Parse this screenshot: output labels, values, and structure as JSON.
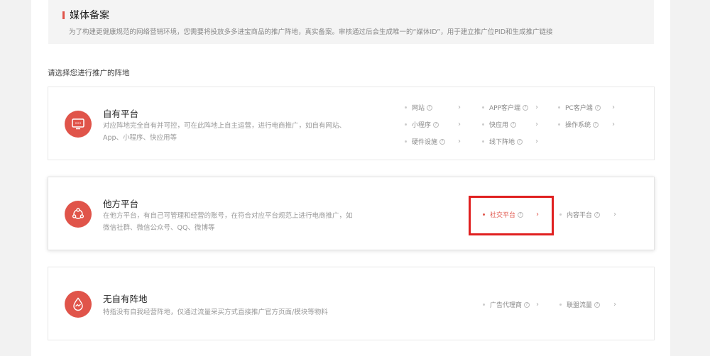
{
  "banner": {
    "title": "媒体备案",
    "description": "为了构建更健康规范的网络营销环境，您需要将投放多多进宝商品的推广阵地，真实备案。审核通过后会生成唯一的“媒体ID”，用于建立推广位PID和生成推广链接"
  },
  "prompt": "请选择您进行推广的阵地",
  "cards": [
    {
      "title": "自有平台",
      "desc": "对应阵地完全自有并可控，可在此阵地上自主运营，进行电商推广，如自有网站、App、小程序、快应用等",
      "icon": "monitor-icon",
      "options": [
        "网站",
        "APP客户端",
        "PC客户端",
        "小程序",
        "快应用",
        "操作系统",
        "硬件设施",
        "线下阵地"
      ]
    },
    {
      "title": "他方平台",
      "desc": "在他方平台，有自己可管理和经营的账号，在符合对应平台规范上进行电商推广，如微信社群、微信公众号、QQ、微博等",
      "icon": "people-icon",
      "options": [
        "社交平台",
        "内容平台"
      ],
      "selected": "社交平台"
    },
    {
      "title": "无自有阵地",
      "desc": "特指没有自我经营阵地，仅通过流量采买方式直接推广官方页面/模块等物料",
      "icon": "droplet-icon",
      "options": [
        "广告代理商",
        "联盟流量"
      ]
    }
  ],
  "glyphs": {
    "help": "?",
    "chevron": "›"
  },
  "colors": {
    "accent": "#e0544a",
    "highlight_box": "#e02020"
  }
}
